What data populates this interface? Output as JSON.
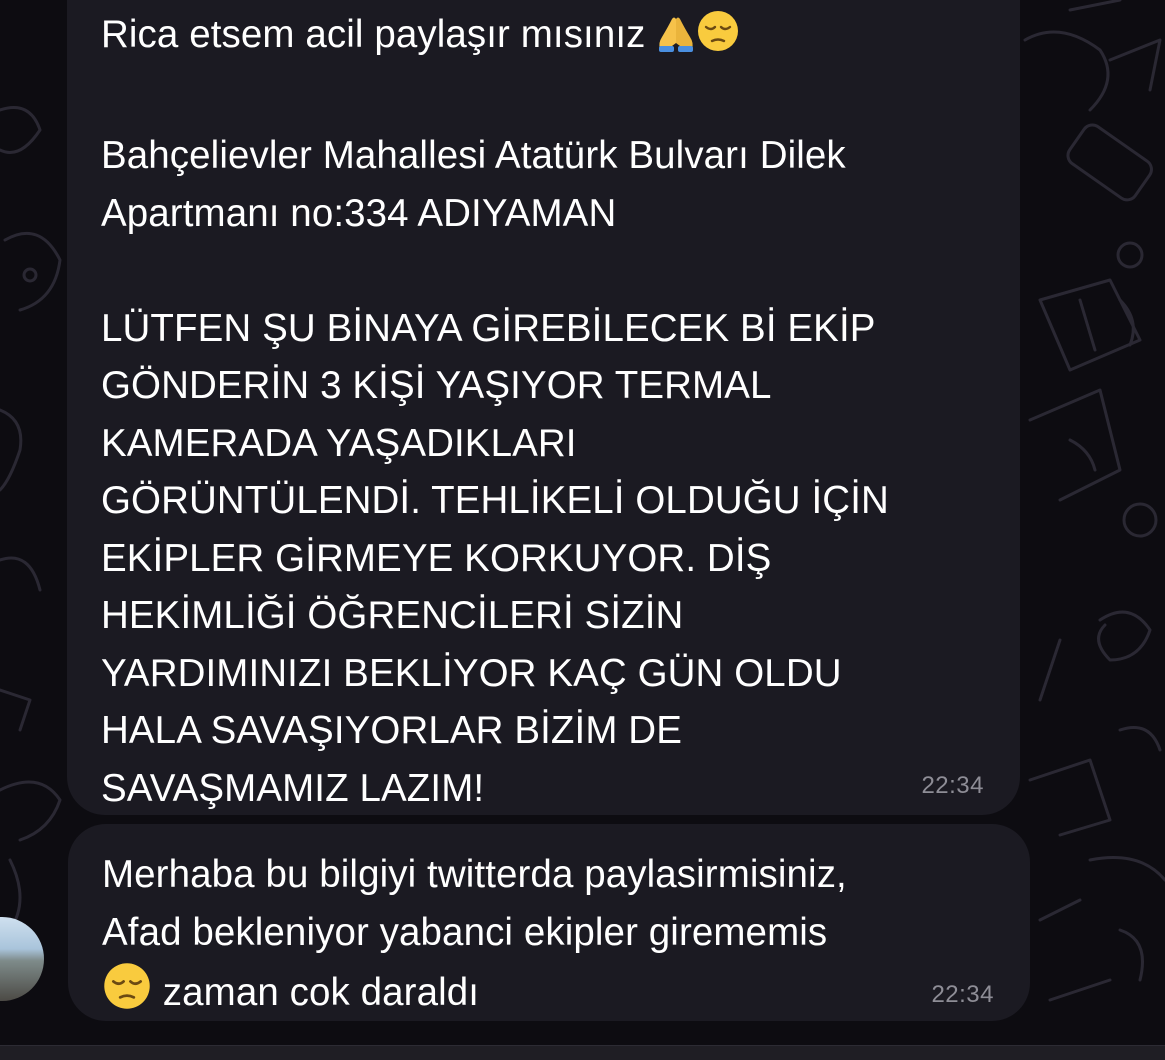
{
  "messages": [
    {
      "lines": [
        {
          "text": "Rica etsem acil paylaşır mısınız ",
          "emojis": [
            "folded-hands",
            "pensive-face"
          ]
        },
        {
          "text": ""
        },
        {
          "text": "Bahçelievler Mahallesi Atatürk Bulvarı Dilek"
        },
        {
          "text": "Apartmanı no:334 ADIYAMAN"
        },
        {
          "text": ""
        },
        {
          "text": "LÜTFEN ŞU BİNAYA GİREBİLECEK Bİ EKİP"
        },
        {
          "text": "GÖNDERİN 3 KİŞİ YAŞIYOR TERMAL"
        },
        {
          "text": "KAMERADA YAŞADIKLARI"
        },
        {
          "text": "GÖRÜNTÜLENDİ. TEHLİKELİ OLDUĞU İÇİN"
        },
        {
          "text": "EKİPLER GİRMEYE KORKUYOR. DİŞ"
        },
        {
          "text": "HEKİMLİĞİ ÖĞRENCİLERİ SİZİN"
        },
        {
          "text": "YARDIMINIZI BEKLİYOR KAÇ GÜN OLDU"
        },
        {
          "text": "HALA SAVAŞIYORLAR BİZİM DE"
        },
        {
          "text": "SAVAŞMAMIZ LAZIM!"
        }
      ],
      "time": "22:34"
    },
    {
      "lines": [
        {
          "text": "Merhaba bu bilgiyi twitterda paylasirmisiniz,"
        },
        {
          "text": "Afad bekleniyor yabanci ekipler girememis"
        },
        {
          "text": " zaman cok daraldı",
          "leading_emoji": "pensive-face"
        }
      ],
      "time": "22:34"
    }
  ],
  "colors": {
    "background": "#0d0c11",
    "bubble": "#1b1a22",
    "text": "#ffffff",
    "time": "#8e8d96"
  }
}
